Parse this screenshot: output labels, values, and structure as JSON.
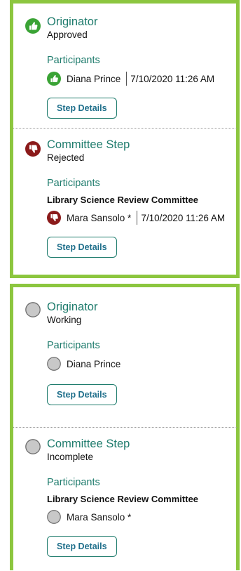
{
  "panels": [
    {
      "steps": [
        {
          "title": "Originator",
          "status": "Approved",
          "status_icon": "thumbs-up-icon",
          "participants_label": "Participants",
          "participants": [
            {
              "name": "Diana Prince",
              "timestamp": "7/10/2020 11:26 AM",
              "icon": "thumbs-up-icon"
            }
          ],
          "button_label": "Step Details"
        },
        {
          "title": "Committee Step",
          "status": "Rejected",
          "status_icon": "thumbs-down-icon",
          "participants_label": "Participants",
          "committee": "Library Science Review Committee",
          "participants": [
            {
              "name": "Mara Sansolo *",
              "timestamp": "7/10/2020 11:26 AM",
              "icon": "thumbs-down-icon"
            }
          ],
          "button_label": "Step Details"
        }
      ]
    },
    {
      "steps": [
        {
          "title": "Originator",
          "status": "Working",
          "status_icon": "pending-circle-icon",
          "participants_label": "Participants",
          "participants": [
            {
              "name": "Diana Prince",
              "icon": "pending-circle-icon"
            }
          ],
          "button_label": "Step Details"
        },
        {
          "title": "Committee Step",
          "status": "Incomplete",
          "status_icon": "pending-circle-icon",
          "participants_label": "Participants",
          "committee": "Library Science Review Committee",
          "participants": [
            {
              "name": "Mara Sansolo *",
              "icon": "pending-circle-icon"
            }
          ],
          "button_label": "Step Details"
        }
      ]
    }
  ],
  "colors": {
    "panel_border": "#8cc63f",
    "approved": "#3aa335",
    "rejected": "#8b1a1a",
    "pending": "#bdbdbd",
    "heading": "#1f7c6d"
  }
}
